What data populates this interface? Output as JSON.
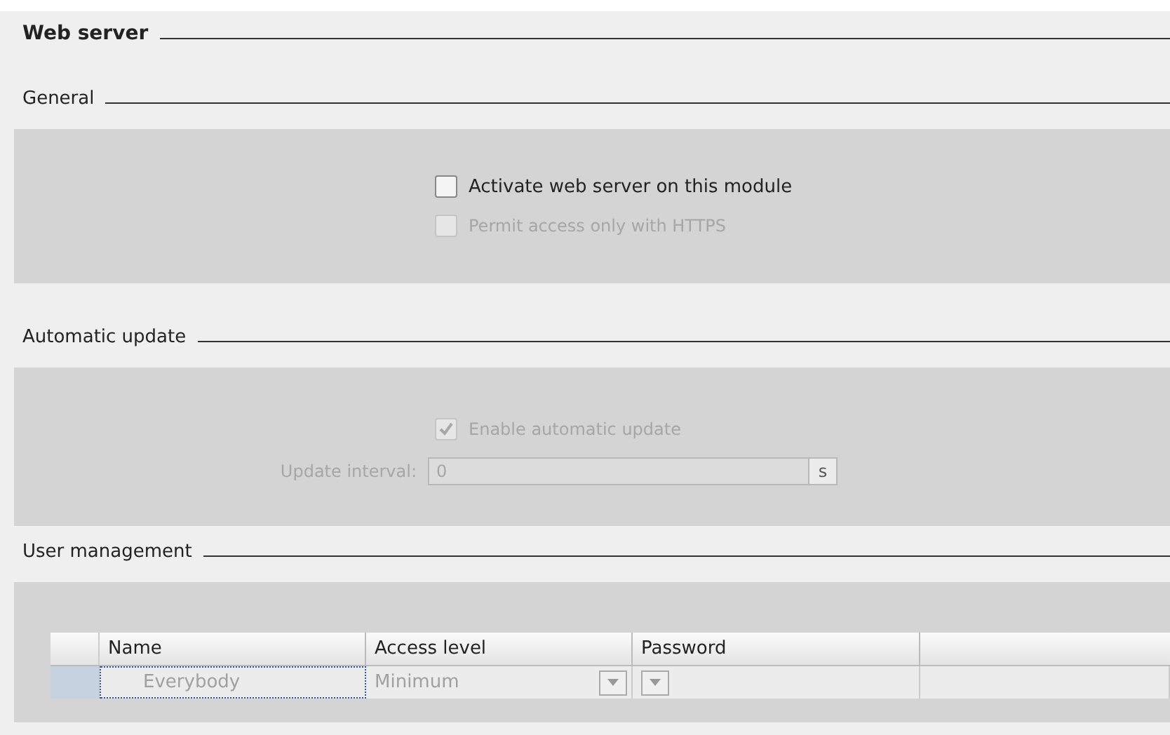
{
  "title": "Web server",
  "general": {
    "heading": "General",
    "options": [
      {
        "label": "Activate web server on this module",
        "checked": false,
        "disabled": false
      },
      {
        "label": "Permit access only with HTTPS",
        "checked": false,
        "disabled": true
      }
    ]
  },
  "automatic_update": {
    "heading": "Automatic update",
    "option": {
      "label": "Enable automatic update",
      "checked": true,
      "disabled": true
    },
    "interval": {
      "label": "Update interval:",
      "value": "0",
      "unit": "s",
      "disabled": true
    }
  },
  "user_management": {
    "heading": "User management",
    "columns": [
      "Name",
      "Access level",
      "Password"
    ],
    "rows": [
      {
        "name": "Everybody",
        "access_level": "Minimum",
        "password": "",
        "selected": true
      }
    ]
  }
}
